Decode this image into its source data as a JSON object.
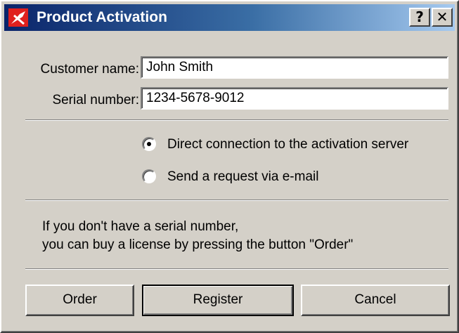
{
  "window": {
    "title": "Product Activation",
    "help_label": "?",
    "close_label": "✕"
  },
  "form": {
    "customer_label": "Customer name:",
    "customer_value": "John Smith",
    "serial_label": "Serial number:",
    "serial_value": "1234-5678-9012"
  },
  "options": [
    {
      "label": "Direct connection to the activation server",
      "selected": true
    },
    {
      "label": "Send a request via e-mail",
      "selected": false
    }
  ],
  "info": {
    "line1": "If you don't have a serial number,",
    "line2": "you can buy a license by pressing the button \"Order\""
  },
  "buttons": {
    "order": "Order",
    "register": "Register",
    "cancel": "Cancel"
  },
  "colors": {
    "titlebar_start": "#0a246a",
    "titlebar_end": "#a6caf0",
    "dialog_face": "#d4d0c8",
    "logo_red": "#e0201e"
  }
}
